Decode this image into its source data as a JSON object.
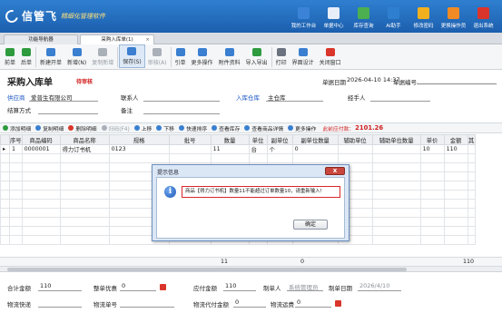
{
  "app": {
    "brand": "信管飞",
    "subtitle": "精细化管理软件",
    "nav": [
      {
        "label": "我的工作台",
        "icon": "monitor-icon",
        "color": "#3b83d6"
      },
      {
        "label": "单据中心",
        "icon": "document-icon",
        "color": "#e8eef7"
      },
      {
        "label": "库存查询",
        "icon": "inventory-icon",
        "color": "#4caf50"
      },
      {
        "label": "AI助手",
        "icon": "info-icon",
        "color": "#2f7fd0"
      },
      {
        "label": "修改密码",
        "icon": "lock-icon",
        "color": "#f2b01e"
      },
      {
        "label": "更换操作员",
        "icon": "user-icon",
        "color": "#f08a24"
      },
      {
        "label": "退出系统",
        "icon": "exit-icon",
        "color": "#d9352a"
      }
    ]
  },
  "tabs": {
    "home": "功能导航器",
    "active": "采购入库单(1)",
    "close": "×"
  },
  "toolbar": {
    "items": [
      {
        "label": "前单",
        "icon": "arrow-left-icon",
        "color": "#2f9b3f",
        "state": "normal"
      },
      {
        "label": "后单",
        "icon": "arrow-right-icon",
        "color": "#2f9b3f",
        "state": "normal"
      },
      {
        "label": "新建开单",
        "icon": "new-doc-icon",
        "color": "#3a7fd0",
        "state": "normal"
      },
      {
        "label": "新增(N)",
        "icon": "plus-icon",
        "color": "#3a7fd0",
        "state": "normal"
      },
      {
        "label": "复制新增",
        "icon": "copy-icon",
        "color": "#aab0b8",
        "state": "disabled"
      },
      {
        "label": "保存(S)",
        "icon": "save-icon",
        "color": "#3a7fd0",
        "state": "active"
      },
      {
        "label": "审核(A)",
        "icon": "approve-icon",
        "color": "#aab0b8",
        "state": "disabled"
      },
      {
        "label": "引单",
        "icon": "import-doc-icon",
        "color": "#3a7fd0",
        "state": "normal"
      },
      {
        "label": "更多操作",
        "icon": "more-icon",
        "color": "#3a7fd0",
        "state": "normal"
      },
      {
        "label": "附件资料",
        "icon": "attachment-icon",
        "color": "#3a7fd0",
        "state": "normal"
      },
      {
        "label": "导入导出",
        "icon": "import-export-icon",
        "color": "#2f9b3f",
        "state": "normal"
      },
      {
        "label": "打印",
        "icon": "print-icon",
        "color": "#6b7280",
        "state": "normal"
      },
      {
        "label": "界面设计",
        "icon": "design-icon",
        "color": "#3a7fd0",
        "state": "normal"
      },
      {
        "label": "关闭窗口",
        "icon": "close-window-icon",
        "color": "#d9352a",
        "state": "normal"
      }
    ]
  },
  "document": {
    "title": "采购入库单",
    "status": "待审核",
    "date_label": "单据日期",
    "date": "2026-04-10 14:37",
    "number_label": "单据编号",
    "supplier_label": "供应商",
    "supplier": "爱普生有限公司",
    "contact_label": "联系人",
    "warehouse_label": "入库仓库",
    "warehouse": "主仓库",
    "handler_label": "经手人",
    "settlement_label": "结算方式",
    "remark_label": "备注"
  },
  "grid_toolbar": {
    "items": [
      {
        "label": "添加明细",
        "icon": "add-row-icon",
        "color": "#2f9b3f",
        "state": "normal"
      },
      {
        "label": "复制明细",
        "icon": "copy-row-icon",
        "color": "#3a7fd0",
        "state": "normal"
      },
      {
        "label": "删除明细",
        "icon": "delete-row-icon",
        "color": "#d9352a",
        "state": "normal"
      },
      {
        "label": "扫码(F4)",
        "icon": "scan-icon",
        "color": "#aab0b8",
        "state": "disabled"
      },
      {
        "label": "上移",
        "icon": "move-up-icon",
        "color": "#3a7fd0",
        "state": "normal"
      },
      {
        "label": "下移",
        "icon": "move-down-icon",
        "color": "#3a7fd0",
        "state": "normal"
      },
      {
        "label": "快速排序",
        "icon": "sort-icon",
        "color": "#3a7fd0",
        "state": "normal"
      },
      {
        "label": "查看库存",
        "icon": "stock-icon",
        "color": "#3a7fd0",
        "state": "normal"
      },
      {
        "label": "查看商品详情",
        "icon": "detail-icon",
        "color": "#3a7fd0",
        "state": "normal"
      },
      {
        "label": "更多操作",
        "icon": "more-icon",
        "color": "#3a7fd0",
        "state": "normal"
      }
    ],
    "total_label": "此前应付款：",
    "total_value": "2101.26"
  },
  "table": {
    "columns": [
      "序号",
      "商品编码",
      "商品名称",
      "规格",
      "批号",
      "数量",
      "单位",
      "副单位",
      "副单位数量",
      "辅助单位",
      "辅助单位数量",
      "单价",
      "金额",
      "其"
    ],
    "rows": [
      {
        "marker": "▸",
        "cells": [
          "1",
          "0000001",
          "得力订书机",
          "0123",
          "",
          "11",
          "台",
          "个",
          "0",
          "",
          "",
          "10",
          "110",
          ""
        ]
      }
    ],
    "sum_quantity": "11",
    "sum_subqty": "0",
    "sum_amount": "110"
  },
  "footer": {
    "total_label": "合计金额",
    "total_value": "110",
    "discount_label": "整单优惠",
    "discount_value": "0",
    "payable_label": "应付金额",
    "payable_value": "110",
    "creator_label": "制单人",
    "creator_value": "系统管理员",
    "created_date_label": "制单日期",
    "created_date_value": "2026/4/10",
    "express_label": "物流快递",
    "tracking_label": "物流单号",
    "collect_label": "物流代付金额",
    "collect_value": "0",
    "freight_label": "物流运费",
    "freight_value": "0"
  },
  "dialog": {
    "title": "提示信息",
    "close": "x",
    "message": "商品【得力订书机】数量11不能超过订单数量10，请重新输入!",
    "ok_label": "确定"
  }
}
